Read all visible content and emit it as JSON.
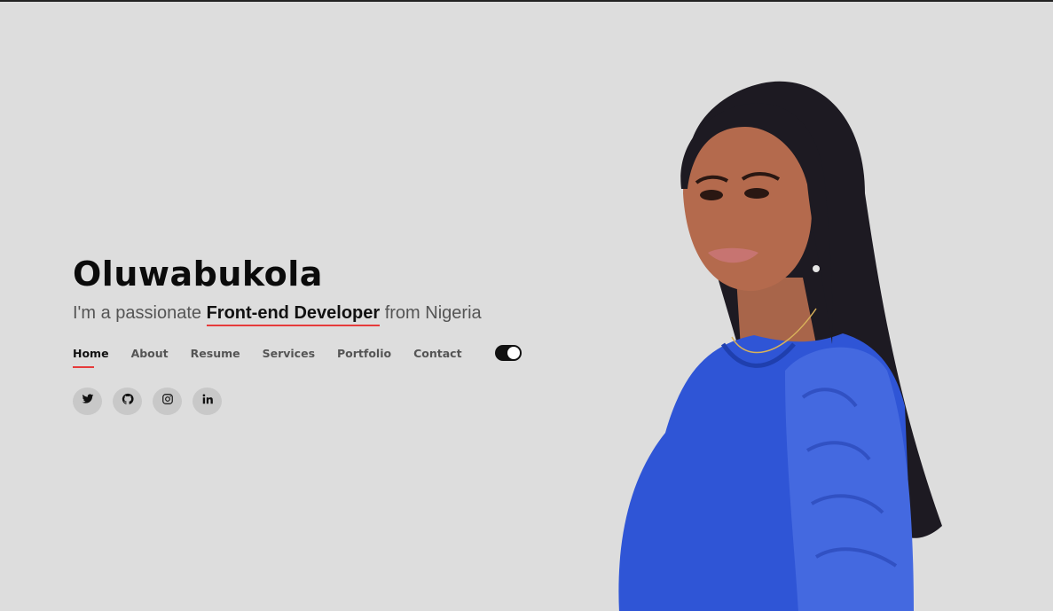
{
  "hero": {
    "name": "Oluwabukola",
    "tagline_prefix": "I'm a passionate ",
    "tagline_role": "Front-end Developer",
    "tagline_suffix": " from Nigeria"
  },
  "nav": {
    "items": [
      {
        "label": "Home",
        "active": true
      },
      {
        "label": "About"
      },
      {
        "label": "Resume"
      },
      {
        "label": "Services"
      },
      {
        "label": "Portfolio"
      },
      {
        "label": "Contact"
      }
    ],
    "theme_toggle_state": "on"
  },
  "social": {
    "icons": [
      "twitter-icon",
      "github-icon",
      "instagram-icon",
      "linkedin-icon"
    ]
  },
  "colors": {
    "background": "#dddddd",
    "accent": "#e63b3b",
    "dress": "#2f55d6"
  }
}
